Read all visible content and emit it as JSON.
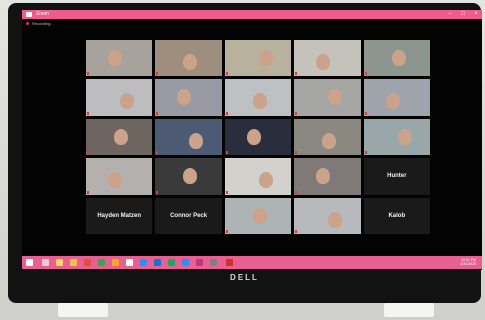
{
  "window": {
    "title": "Zoom"
  },
  "status": {
    "recording_label": "Recording..."
  },
  "brand": {
    "logo_text": "DELL"
  },
  "taskbar": {
    "time": "10:01 PM",
    "date": "3/31/2020"
  },
  "participants": [
    {
      "name": "",
      "kind": "video",
      "bg": "#a7a39c"
    },
    {
      "name": "",
      "kind": "video",
      "bg": "#9d8e7e"
    },
    {
      "name": "",
      "kind": "video",
      "bg": "#b8b19d"
    },
    {
      "name": "",
      "kind": "video",
      "bg": "#c5c2bb"
    },
    {
      "name": "",
      "kind": "video",
      "bg": "#8d9590"
    },
    {
      "name": "",
      "kind": "video",
      "bg": "#bdbcbe"
    },
    {
      "name": "",
      "kind": "video",
      "bg": "#9a9aa5"
    },
    {
      "name": "",
      "kind": "video",
      "bg": "#bfc0c3"
    },
    {
      "name": "",
      "kind": "video",
      "bg": "#a5a6a3"
    },
    {
      "name": "",
      "kind": "video",
      "bg": "#9ea3ac"
    },
    {
      "name": "",
      "kind": "video",
      "bg": "#6e6560"
    },
    {
      "name": "",
      "kind": "video",
      "bg": "#4d5a74"
    },
    {
      "name": "",
      "kind": "video",
      "bg": "#2a2d3b"
    },
    {
      "name": "",
      "kind": "video",
      "bg": "#8b8882"
    },
    {
      "name": "",
      "kind": "video",
      "bg": "#9aa7a8"
    },
    {
      "name": "",
      "kind": "video",
      "bg": "#b4b0ad"
    },
    {
      "name": "",
      "kind": "video",
      "bg": "#3a3a3a"
    },
    {
      "name": "",
      "kind": "video",
      "bg": "#d3d1cc"
    },
    {
      "name": "",
      "kind": "video",
      "bg": "#7f7a78"
    },
    {
      "name": "Hunter",
      "kind": "name",
      "bg": "#1a1a1a"
    },
    {
      "name": "Hayden Matzen",
      "kind": "name",
      "bg": "#1a1a1a"
    },
    {
      "name": "Connor Peck",
      "kind": "name",
      "bg": "#1a1a1a"
    },
    {
      "name": "",
      "kind": "video",
      "bg": "#aeb3b5"
    },
    {
      "name": "",
      "kind": "video",
      "bg": "#b7b9bd"
    },
    {
      "name": "Kalob",
      "kind": "name",
      "bg": "#1a1a1a"
    }
  ],
  "colors": {
    "accent": "#ef5b8b",
    "taskbar": "#e7608f"
  }
}
